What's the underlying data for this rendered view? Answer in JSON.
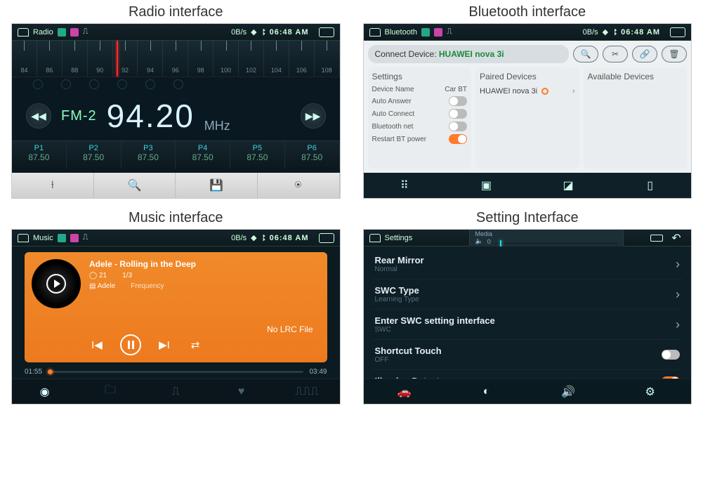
{
  "titles": {
    "radio": "Radio interface",
    "bluetooth": "Bluetooth interface",
    "music": "Music interface",
    "settings": "Setting Interface"
  },
  "status": {
    "rate": "0B/s",
    "time": "06:48 AM"
  },
  "radio": {
    "app": "Radio",
    "scale": [
      "84",
      "86",
      "88",
      "90",
      "92",
      "94",
      "96",
      "98",
      "100",
      "102",
      "104",
      "106",
      "108"
    ],
    "band": "FM-2",
    "freq": "94.20",
    "unit": "MHz",
    "presets": [
      {
        "label": "P1",
        "value": "87.50"
      },
      {
        "label": "P2",
        "value": "87.50"
      },
      {
        "label": "P3",
        "value": "87.50"
      },
      {
        "label": "P4",
        "value": "87.50"
      },
      {
        "label": "P5",
        "value": "87.50"
      },
      {
        "label": "P6",
        "value": "87.50"
      }
    ]
  },
  "bluetooth": {
    "app": "Bluetooth",
    "connect_label": "Connect Device:",
    "connect_device": "HUAWEI nova 3i",
    "settings_title": "Settings",
    "settings": [
      {
        "label": "Device Name",
        "value": "Car BT",
        "type": "text"
      },
      {
        "label": "Auto Answer",
        "type": "toggle",
        "on": false
      },
      {
        "label": "Auto Connect",
        "type": "toggle",
        "on": false
      },
      {
        "label": "Bluetooth net",
        "type": "toggle",
        "on": false
      },
      {
        "label": "Restart BT power",
        "type": "toggle",
        "on": true
      }
    ],
    "paired_title": "Paired Devices",
    "paired": [
      {
        "name": "HUAWEI nova 3i"
      }
    ],
    "available_title": "Available Devices"
  },
  "music": {
    "app": "Music",
    "title": "Adele - Rolling in the Deep",
    "track_no": "21",
    "track_pos": "1/3",
    "artist": "Adele",
    "freq_label": "Frequency",
    "nolrc": "No LRC File",
    "time_cur": "01:55",
    "time_total": "03:49"
  },
  "settings": {
    "app": "Settings",
    "vol_label": "Media",
    "vol_value": "0",
    "items": [
      {
        "label": "Rear Mirror",
        "sub": "Normal",
        "type": "nav"
      },
      {
        "label": "SWC Type",
        "sub": "Learning Type",
        "type": "nav"
      },
      {
        "label": "Enter SWC setting interface",
        "sub": "SWC",
        "type": "nav"
      },
      {
        "label": "Shortcut Touch",
        "sub": "OFF",
        "type": "toggle",
        "on": false
      },
      {
        "label": "Illumine Detect",
        "sub": "",
        "type": "toggle",
        "on": true
      }
    ]
  }
}
